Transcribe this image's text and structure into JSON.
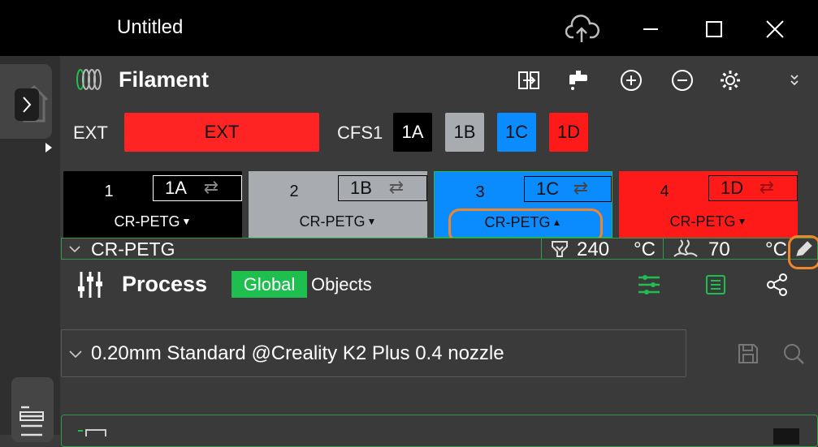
{
  "window": {
    "title": "Untitled"
  },
  "filament": {
    "title": "Filament",
    "ext_label": "EXT",
    "ext_button": "EXT",
    "cfs_label": "CFS1",
    "chips": [
      {
        "label": "1A",
        "bg": "#000000",
        "fg": "#ffffff"
      },
      {
        "label": "1B",
        "bg": "#a8abb0",
        "fg": "#111111"
      },
      {
        "label": "1C",
        "bg": "#0a8cff",
        "fg": "#111111"
      },
      {
        "label": "1D",
        "bg": "#ff1a1a",
        "fg": "#111111"
      }
    ],
    "cards": [
      {
        "num": "1",
        "slot": "1A",
        "material": "CR-PETG",
        "bg": "#000000",
        "fg": "#ffffff",
        "arrow": "down"
      },
      {
        "num": "2",
        "slot": "1B",
        "material": "CR-PETG",
        "bg": "#a8abb0",
        "fg": "#111111",
        "arrow": "down"
      },
      {
        "num": "3",
        "slot": "1C",
        "material": "CR-PETG",
        "bg": "#0a8cff",
        "fg": "#111111",
        "arrow": "up"
      },
      {
        "num": "4",
        "slot": "1D",
        "material": "CR-PETG",
        "bg": "#ff1a1a",
        "fg": "#111111",
        "arrow": "down"
      }
    ],
    "preset": {
      "name": "CR-PETG",
      "nozzle_temp": "240",
      "nozzle_unit": "°C",
      "bed_temp": "70",
      "bed_unit": "°C"
    }
  },
  "process": {
    "title": "Process",
    "tab_global": "Global",
    "tab_objects": "Objects",
    "preset_name": "0.20mm Standard @Creality K2 Plus 0.4 nozzle"
  },
  "colors": {
    "accent_green": "#1fbf4f",
    "highlight_orange": "#f0862b",
    "ext_red": "#ff2424"
  }
}
